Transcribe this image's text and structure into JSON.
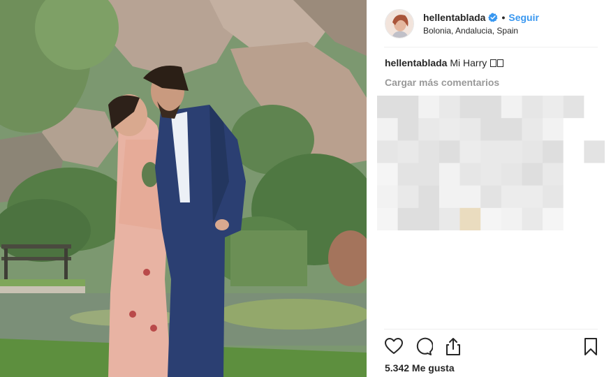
{
  "post": {
    "username": "hellentablada",
    "verified": true,
    "follow_label": "Seguir",
    "separator": "•",
    "location": "Bolonia, Andalucia, Spain",
    "caption_user": "hellentablada",
    "caption_text": "Mi Harry",
    "caption_glyphs": 2,
    "load_more": "Cargar más comentarios",
    "likes": "5.342 Me gusta"
  },
  "icons": {
    "verified": "verified-badge-icon",
    "like": "heart-icon",
    "comment": "comment-icon",
    "share": "share-icon",
    "save": "bookmark-icon"
  },
  "colors": {
    "link": "#3897f0",
    "muted": "#999999",
    "text": "#262626",
    "divider": "#efefef"
  }
}
